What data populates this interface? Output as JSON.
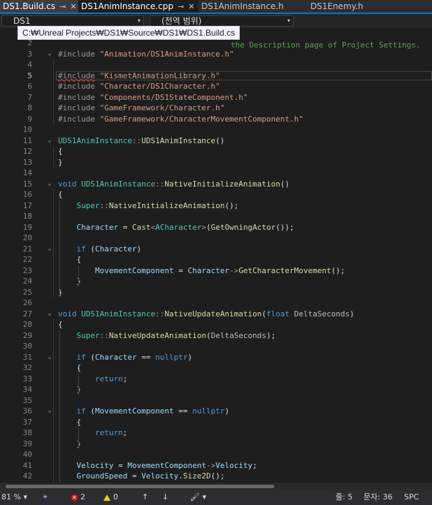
{
  "tabs": [
    {
      "label": "DS1.Build.cs",
      "state": "pinned"
    },
    {
      "label": "DS1AnimInstance.cpp",
      "state": "active"
    },
    {
      "label": "DS1AnimInstance.h",
      "state": "inactive"
    },
    {
      "label": "DS1Enemy.h",
      "state": "inactive"
    }
  ],
  "tab_icons": {
    "pin": "⊸",
    "close": "✕"
  },
  "navbar": {
    "project": "DS1",
    "scope": "(전역 범위)"
  },
  "tooltip": "C:₩Unreal Projects₩DS1₩Source₩DS1₩DS1.Build.cs",
  "top_partial": "the Description page of Project Settings.",
  "code_lines": [
    {
      "n": "2",
      "html": ""
    },
    {
      "n": "3",
      "html": "<span class='pr'>#include</span> <span class='s'>\"Animation/DS1AnimInstance.h\"</span>"
    },
    {
      "n": "4",
      "html": ""
    },
    {
      "n": "5",
      "html": "<span class='pr sq'>#include</span> <span class='s'>\"KismetAnimationLibrary.h\"</span>"
    },
    {
      "n": "6",
      "html": "<span class='pr'>#include</span> <span class='s'>\"Character/DS1Character.h\"</span>"
    },
    {
      "n": "7",
      "html": "<span class='pr'>#include</span> <span class='s'>\"Components/DS1StateComponent.h\"</span>"
    },
    {
      "n": "8",
      "html": "<span class='pr'>#include</span> <span class='s'>\"GameFramework/Character.h\"</span>"
    },
    {
      "n": "9",
      "html": "<span class='pr'>#include</span> <span class='s'>\"GameFramework/CharacterMovementComponent.h\"</span>"
    },
    {
      "n": "10",
      "html": ""
    },
    {
      "n": "11",
      "html": "<span class='t'>UDS1AnimInstance</span><span class='p'>::</span><span class='f'>UDS1AnimInstance</span>()"
    },
    {
      "n": "12",
      "html": "{"
    },
    {
      "n": "13",
      "html": "}"
    },
    {
      "n": "14",
      "html": ""
    },
    {
      "n": "15",
      "html": "<span class='k'>void</span> <span class='t'>UDS1AnimInstance</span><span class='p'>::</span><span class='f'>NativeInitializeAnimation</span>()"
    },
    {
      "n": "16",
      "html": "{"
    },
    {
      "n": "17",
      "html": "    <span class='t'>Super</span><span class='p'>::</span><span class='f'>NativeInitializeAnimation</span>();"
    },
    {
      "n": "18",
      "html": ""
    },
    {
      "n": "19",
      "html": "    <span class='v'>Character</span> = <span class='f'>Cast</span><span class='p'>&lt;</span><span class='t'>ACharacter</span><span class='p'>&gt;</span>(<span class='f'>GetOwningActor</span>());"
    },
    {
      "n": "20",
      "html": ""
    },
    {
      "n": "21",
      "html": "    <span class='k'>if</span> (<span class='v'>Character</span>)"
    },
    {
      "n": "22",
      "html": "    {"
    },
    {
      "n": "23",
      "html": "        <span class='v'>MovementComponent</span> = <span class='v'>Character</span><span class='p'>-&gt;</span><span class='f'>GetCharacterMovement</span>();"
    },
    {
      "n": "24",
      "html": "    }"
    },
    {
      "n": "25",
      "html": "}"
    },
    {
      "n": "26",
      "html": ""
    },
    {
      "n": "27",
      "html": "<span class='k'>void</span> <span class='t'>UDS1AnimInstance</span><span class='p'>::</span><span class='f'>NativeUpdateAnimation</span>(<span class='k'>float</span> <span class='m'>DeltaSeconds</span>)"
    },
    {
      "n": "28",
      "html": "{"
    },
    {
      "n": "29",
      "html": "    <span class='t'>Super</span><span class='p'>::</span><span class='f'>NativeUpdateAnimation</span>(<span class='m'>DeltaSeconds</span>);"
    },
    {
      "n": "30",
      "html": ""
    },
    {
      "n": "31",
      "html": "    <span class='k'>if</span> (<span class='v'>Character</span> == <span class='k'>nullptr</span>)"
    },
    {
      "n": "32",
      "html": "    {"
    },
    {
      "n": "33",
      "html": "        <span class='k'>return</span>;"
    },
    {
      "n": "34",
      "html": "    }"
    },
    {
      "n": "35",
      "html": ""
    },
    {
      "n": "36",
      "html": "    <span class='k'>if</span> (<span class='v'>MovementComponent</span> == <span class='k'>nullptr</span>)"
    },
    {
      "n": "37",
      "html": "    {"
    },
    {
      "n": "38",
      "html": "        <span class='k'>return</span>;"
    },
    {
      "n": "39",
      "html": "    }"
    },
    {
      "n": "40",
      "html": ""
    },
    {
      "n": "41",
      "html": "    <span class='v'>Velocity</span> = <span class='v'>MovementComponent</span><span class='p'>-&gt;</span><span class='v'>Velocity</span>;"
    },
    {
      "n": "42",
      "html": "    <span class='v'>GroundSpeed</span> = <span class='v'>Velocity</span>.<span class='f'>Size2D</span>();"
    }
  ],
  "current_line": "5",
  "fold_lines": [
    "3",
    "11",
    "15",
    "21",
    "27",
    "31",
    "36"
  ],
  "status": {
    "zoom": "81 %",
    "errors": "2",
    "warnings": "0",
    "line": "줄: 5",
    "col": "문자: 36",
    "mode": "SPC"
  },
  "status_icons": {
    "ai": "✦",
    "up": "↑",
    "down": "↓",
    "brush": "🖌",
    "dropdown": "▾"
  },
  "colors": {
    "accent": "#007acc",
    "error": "#e51400",
    "warning": "#ffcc00"
  }
}
